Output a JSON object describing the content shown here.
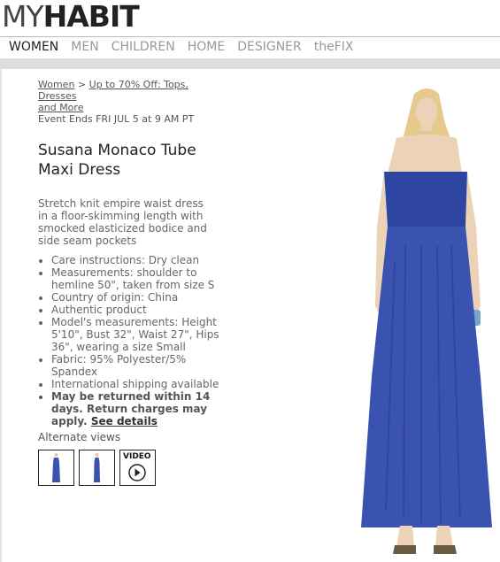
{
  "logo": {
    "my": "MY",
    "habit": "HABIT"
  },
  "nav": [
    "WOMEN",
    "MEN",
    "CHILDREN",
    "HOME",
    "DESIGNER",
    "theFIX"
  ],
  "breadcrumb": {
    "root": "Women",
    "sep": ">",
    "event_line1": "Up to 70% Off: Tops, Dresses",
    "event_line2": "and More"
  },
  "event_ends": "Event Ends FRI JUL 5 at 9 AM PT",
  "product": {
    "title_line1": "Susana Monaco Tube",
    "title_line2": "Maxi Dress",
    "description": "Stretch knit empire waist dress in a floor-skimming length with smocked elasticized bodice and side seam pockets",
    "bullets": [
      "Care instructions: Dry clean",
      "Measurements: shoulder to hemline 50\", taken from size S",
      "Country of origin: China",
      "Authentic product",
      "Model's measurements: Height 5'10\", Bust 32\", Waist 27\", Hips 36\", wearing a size Small",
      "Fabric: 95% Polyester/5% Spandex",
      "International shipping available"
    ],
    "returns_text": "May be returned within 14 days. Return charges may apply.",
    "returns_link": "See details"
  },
  "alternate_views": {
    "label": "Alternate views",
    "video_label": "VIDEO"
  },
  "colors": {
    "dress": "#3a52b0",
    "nav_active": "#222222",
    "nav_inactive": "#999999",
    "bar": "#dddddd"
  }
}
